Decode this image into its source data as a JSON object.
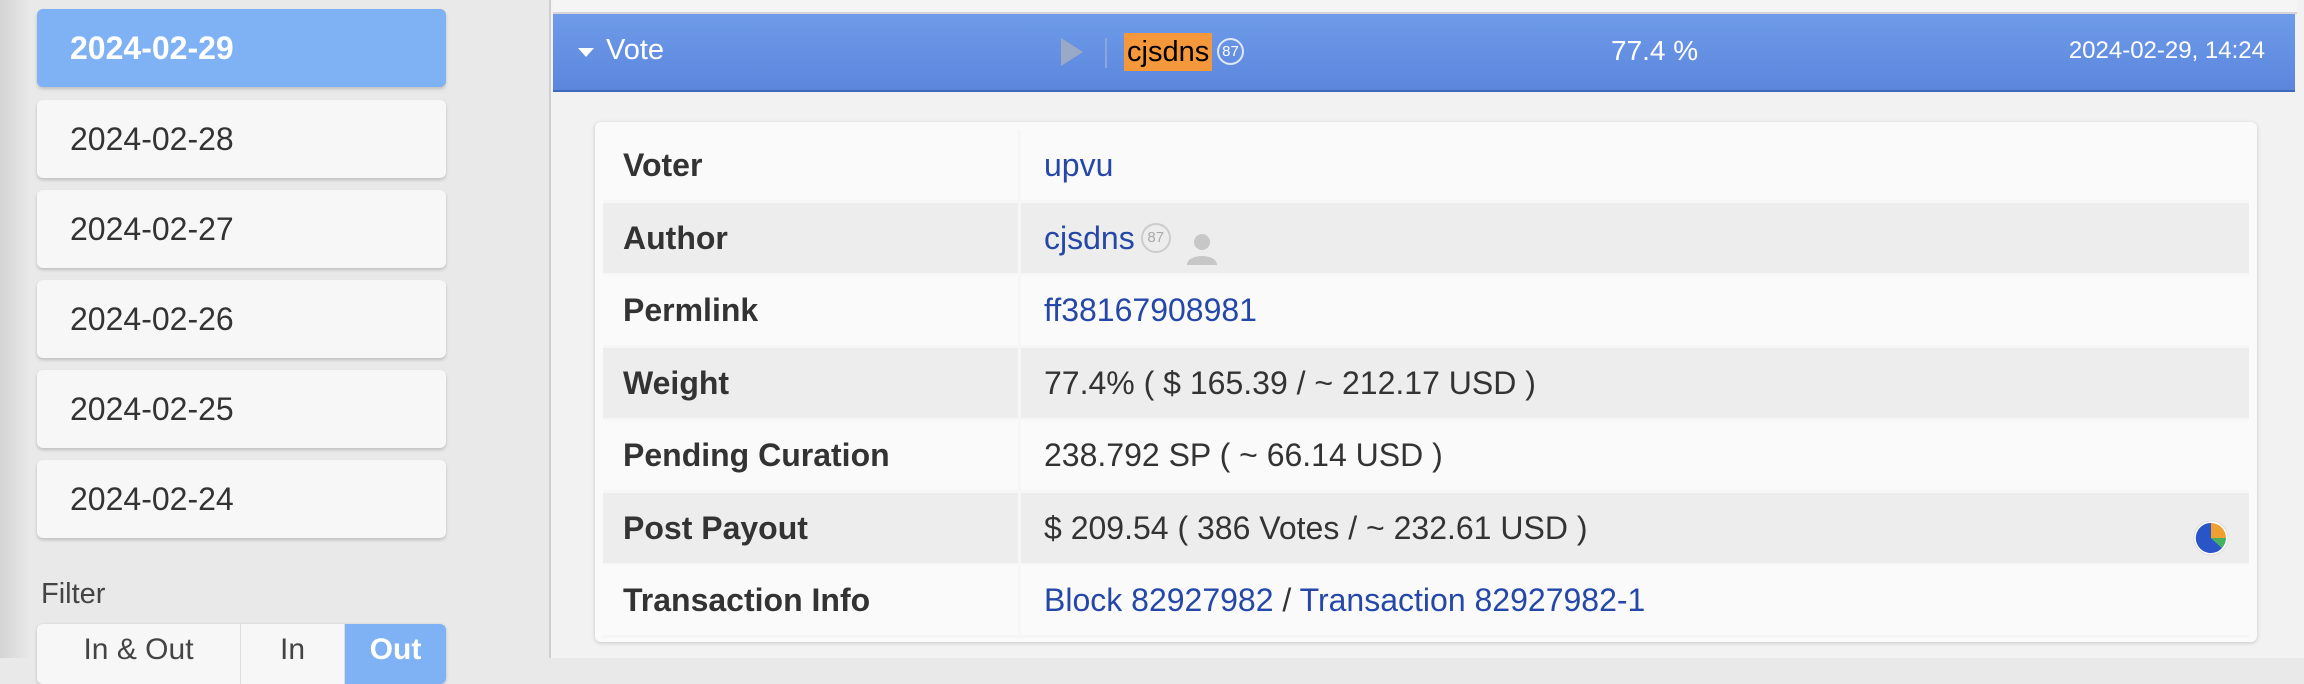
{
  "sidebar": {
    "dates": [
      "2024-02-29",
      "2024-02-28",
      "2024-02-27",
      "2024-02-26",
      "2024-02-25",
      "2024-02-24"
    ],
    "active_index": 0,
    "filter_label": "Filter",
    "filter_options": [
      "In & Out",
      "In",
      "Out"
    ],
    "filter_active": "Out"
  },
  "vote": {
    "title": "Vote",
    "author_tag": "cjsdns",
    "author_rep": "87",
    "percent": "77.4 %",
    "timestamp": "2024-02-29, 14:24"
  },
  "details": {
    "voter_label": "Voter",
    "voter": "upvu",
    "author_label": "Author",
    "author": "cjsdns",
    "author_rep": "87",
    "permlink_label": "Permlink",
    "permlink": "ff38167908981",
    "weight_label": "Weight",
    "weight": "77.4% ( $ 165.39 / ~ 212.17 USD )",
    "pending_label": "Pending Curation",
    "pending": "238.792 SP ( ~ 66.14 USD )",
    "payout_label": "Post Payout",
    "payout": "$ 209.54 ( 386 Votes / ~ 232.61 USD )",
    "tx_label": "Transaction Info",
    "block_link": "Block 82927982",
    "tx_separator": " / ",
    "tx_link": "Transaction 82927982-1"
  },
  "colors": {
    "accent": "#7fb1f5",
    "header": "#5b86dc",
    "author_highlight": "#f5983b",
    "link": "#2447a8"
  }
}
